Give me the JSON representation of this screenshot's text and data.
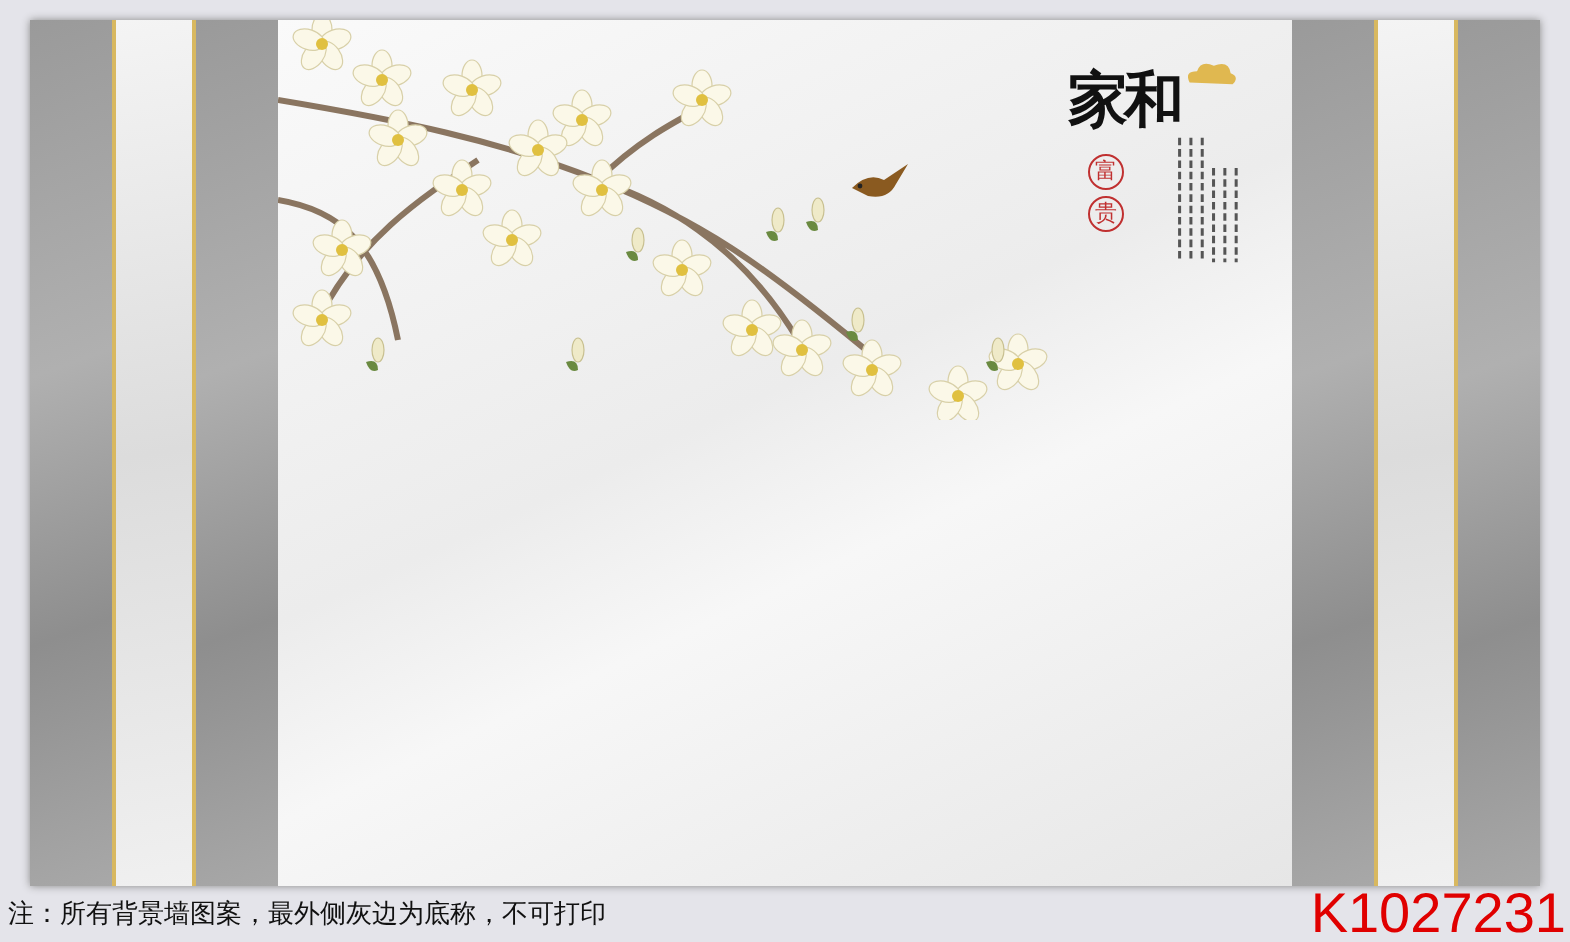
{
  "calligraphy": {
    "title": "家和",
    "seal_chars": [
      "富",
      "贵"
    ]
  },
  "note": "注：所有背景墙图案，最外侧灰边为底称，不可打印",
  "code": "K1027231"
}
